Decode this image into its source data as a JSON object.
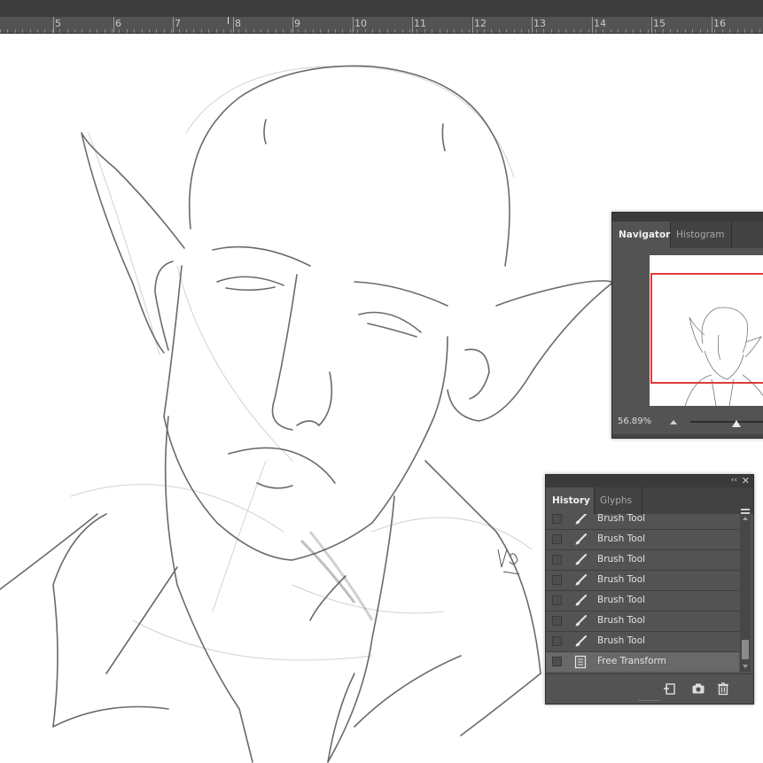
{
  "ruler": {
    "numbers": [
      "5",
      "6",
      "7",
      "8",
      "9",
      "10",
      "11",
      "12",
      "13",
      "14",
      "15",
      "16"
    ]
  },
  "navigator": {
    "tabs": [
      {
        "label": "Navigator"
      },
      {
        "label": "Histogram"
      }
    ],
    "zoom": "56.89%",
    "zoom_slider_fraction": 0.52
  },
  "history": {
    "tabs": [
      {
        "label": "History"
      },
      {
        "label": "Glyphs"
      }
    ],
    "collapse_label": "‹‹",
    "close_label": "✕",
    "items": [
      {
        "label": "Brush Tool",
        "icon": "brush-icon"
      },
      {
        "label": "Brush Tool",
        "icon": "brush-icon"
      },
      {
        "label": "Brush Tool",
        "icon": "brush-icon"
      },
      {
        "label": "Brush Tool",
        "icon": "brush-icon"
      },
      {
        "label": "Brush Tool",
        "icon": "brush-icon"
      },
      {
        "label": "Brush Tool",
        "icon": "brush-icon"
      },
      {
        "label": "Brush Tool",
        "icon": "brush-icon"
      },
      {
        "label": "Free Transform",
        "icon": "document-icon",
        "selected": true
      }
    ],
    "footer_buttons": [
      "new-document-from-state-icon",
      "camera-icon",
      "trash-icon"
    ]
  },
  "colors": {
    "panel": "#535353",
    "panel_dark": "#424242",
    "ruler": "#535353",
    "view_box": "#e03a3a",
    "selected_row": "#696969"
  }
}
